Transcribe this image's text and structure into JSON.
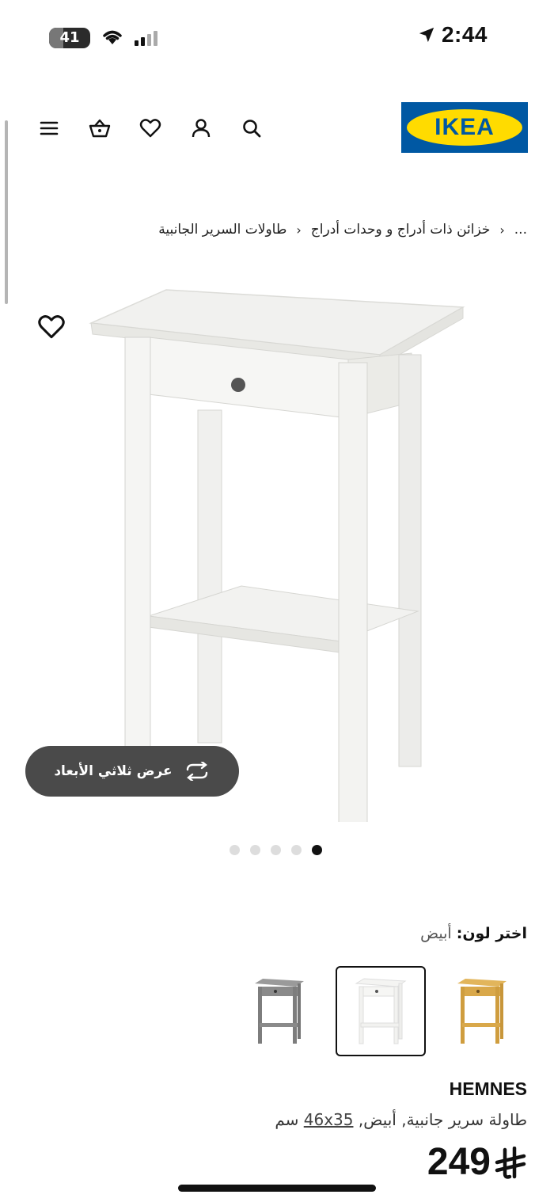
{
  "status_bar": {
    "time": "2:44",
    "battery": "41",
    "icons": [
      "battery-icon",
      "wifi-icon",
      "signal-icon",
      "location-arrow-icon"
    ]
  },
  "header": {
    "logo_text": "IKEA",
    "icons": [
      "search-icon",
      "account-icon",
      "wishlist-icon",
      "cart-icon",
      "menu-icon"
    ],
    "colors": {
      "logo_blue": "#0058a3",
      "logo_yellow": "#ffdb00"
    }
  },
  "breadcrumb": {
    "ellipsis": "...",
    "items": [
      "خزائن ذات أدراج و وحدات أدراج",
      "طاولات السرير الجانبية"
    ]
  },
  "gallery": {
    "view_3d_label": "عرض ثلاثي الأبعاد",
    "slide_count": 5,
    "active_slide": 1
  },
  "color_select": {
    "label": "اختر لون:",
    "selected_value": "أبيض",
    "options": [
      {
        "name": "yellow-brown",
        "color": "#d9a84a"
      },
      {
        "name": "white",
        "color": "#f4f4f2"
      },
      {
        "name": "grey",
        "color": "#8a8a8a"
      }
    ],
    "selected_index": 1
  },
  "product": {
    "brand": "HEMNES",
    "description": "طاولة سرير جانبية, أبيض,",
    "dimensions": "46x35",
    "unit": "سم",
    "price": "249",
    "currency_icon": "saudi-riyal-icon"
  }
}
